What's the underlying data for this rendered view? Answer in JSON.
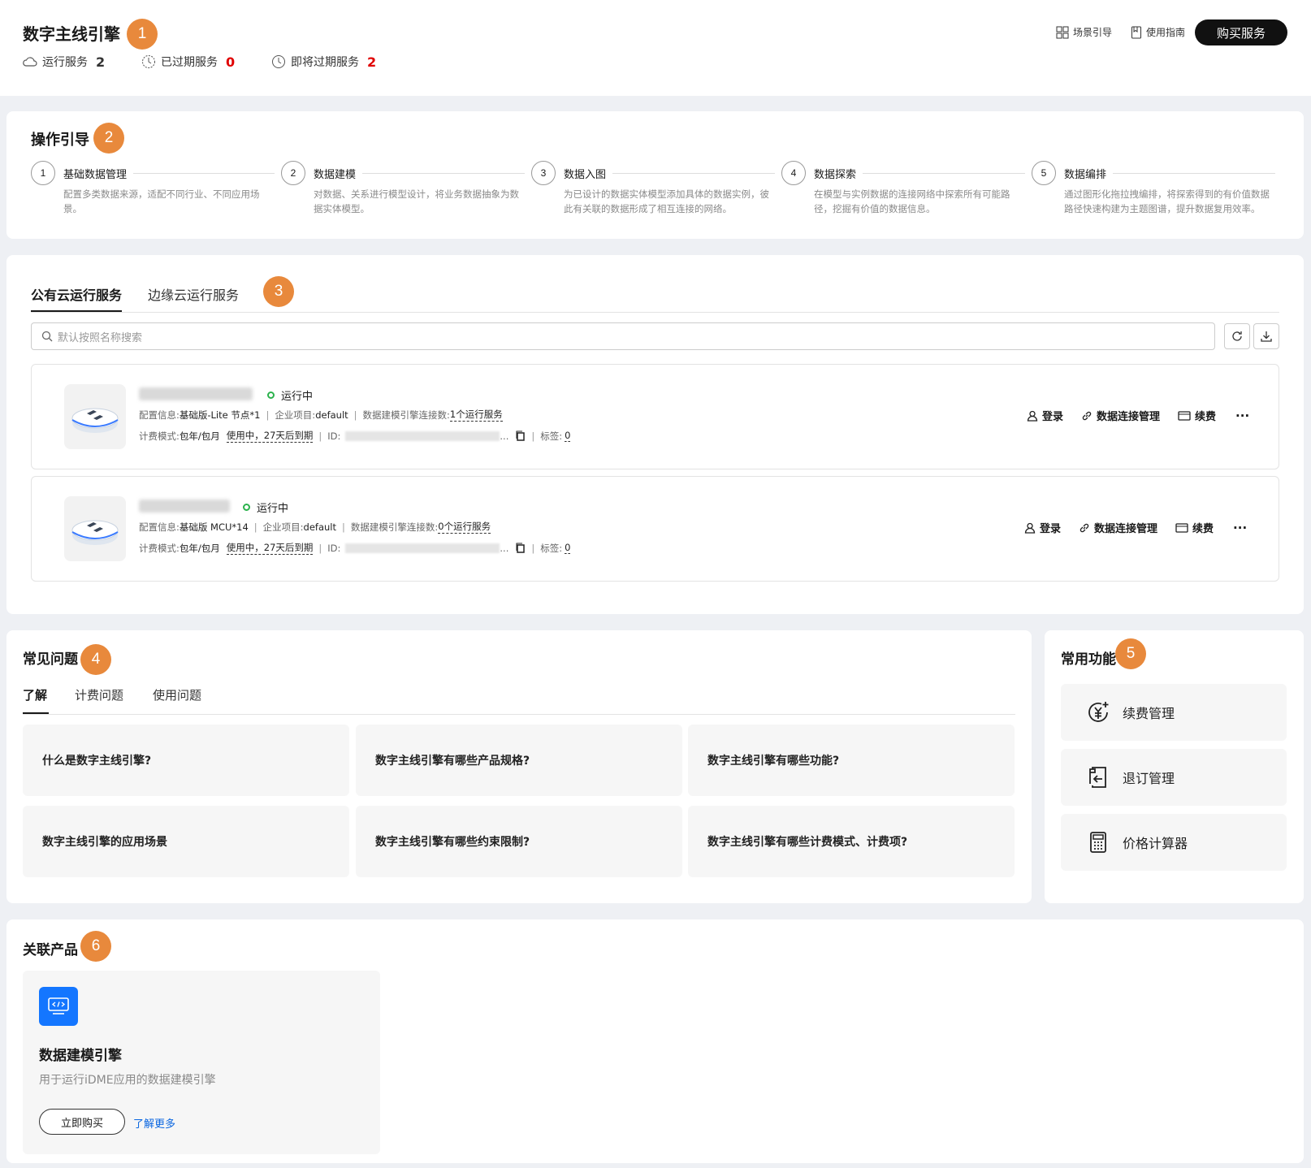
{
  "header": {
    "title": "数字主线引擎",
    "stats": [
      {
        "label": "运行服务",
        "value": "2"
      },
      {
        "label": "已过期服务",
        "value": "0"
      },
      {
        "label": "即将过期服务",
        "value": "2"
      }
    ],
    "scene_guide": "场景引导",
    "user_guide": "使用指南",
    "buy_button": "购买服务"
  },
  "badges": [
    "1",
    "2",
    "3",
    "4",
    "5",
    "6"
  ],
  "guide": {
    "title": "操作引导",
    "steps": [
      {
        "num": "1",
        "title": "基础数据管理",
        "desc": "配置多类数据来源，适配不同行业、不同应用场景。"
      },
      {
        "num": "2",
        "title": "数据建模",
        "desc": "对数据、关系进行模型设计，将业务数据抽象为数据实体模型。"
      },
      {
        "num": "3",
        "title": "数据入图",
        "desc": "为已设计的数据实体模型添加具体的数据实例，彼此有关联的数据形成了相互连接的网络。"
      },
      {
        "num": "4",
        "title": "数据探索",
        "desc": "在模型与实例数据的连接网络中探索所有可能路径，挖掘有价值的数据信息。"
      },
      {
        "num": "5",
        "title": "数据编排",
        "desc": "通过图形化拖拉拽编排，将探索得到的有价值数据路径快速构建为主题图谱，提升数据复用效率。"
      }
    ]
  },
  "services": {
    "tabs": [
      "公有云运行服务",
      "边缘云运行服务"
    ],
    "search_placeholder": "默认按照名称搜索",
    "instances": [
      {
        "status": "运行中",
        "config_label": "配置信息:",
        "config": "基础版-Lite 节点*1",
        "proj_label": "企业项目:",
        "proj": "default",
        "conn_label": "数据建模引擎连接数:",
        "conn": "1个运行服务",
        "bill_label": "计费模式:",
        "bill": "包年/包月",
        "expire": "使用中，27天后到期",
        "id_label": "ID:",
        "tag_label": "标签:",
        "tag": "0"
      },
      {
        "status": "运行中",
        "config_label": "配置信息:",
        "config": "基础版 MCU*14",
        "proj_label": "企业项目:",
        "proj": "default",
        "conn_label": "数据建模引擎连接数:",
        "conn": "0个运行服务",
        "bill_label": "计费模式:",
        "bill": "包年/包月",
        "expire": "使用中，27天后到期",
        "id_label": "ID:",
        "tag_label": "标签:",
        "tag": "0"
      }
    ],
    "actions": {
      "login": "登录",
      "conn": "数据连接管理",
      "renew": "续费",
      "more": "···"
    },
    "ellipsis": "..."
  },
  "faq": {
    "title": "常见问题",
    "tabs": [
      "了解",
      "计费问题",
      "使用问题"
    ],
    "items": [
      "什么是数字主线引擎?",
      "数字主线引擎有哪些产品规格?",
      "数字主线引擎有哪些功能?",
      "数字主线引擎的应用场景",
      "数字主线引擎有哪些约束限制?",
      "数字主线引擎有哪些计费模式、计费项?"
    ]
  },
  "functions": {
    "title": "常用功能",
    "items": [
      "续费管理",
      "退订管理",
      "价格计算器"
    ]
  },
  "related": {
    "title": "关联产品",
    "product": {
      "name": "数据建模引擎",
      "desc": "用于运行iDME应用的数据建模引擎",
      "buy": "立即购买",
      "more": "了解更多"
    }
  },
  "colors": {
    "badge": "#e8893c",
    "running": "#2bb24c",
    "alert": "#e00000",
    "link": "#0a66e0"
  }
}
